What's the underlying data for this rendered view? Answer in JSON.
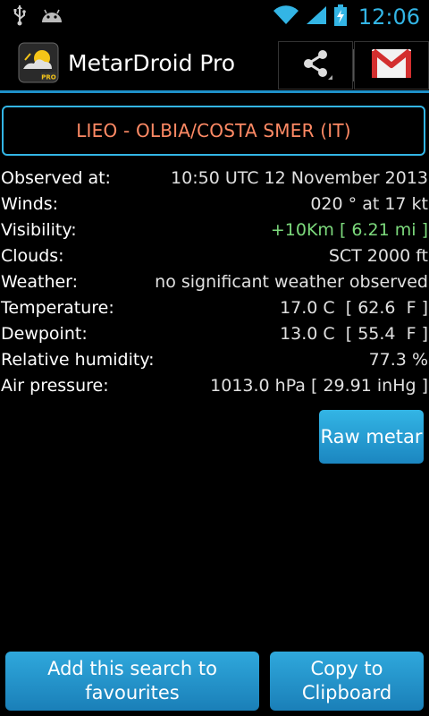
{
  "statusbar": {
    "time": "12:06",
    "icons": [
      "usb-icon",
      "android-icon",
      "wifi-icon",
      "signal-icon",
      "battery-charging-icon"
    ],
    "accent": "#33b5e5"
  },
  "actionbar": {
    "title": "MetarDroid Pro",
    "icon": "metardroid-logo-icon",
    "icon_badge": "PRO",
    "actions": [
      "share-icon",
      "gmail-icon"
    ]
  },
  "station": {
    "label": "LIEO - OLBIA/COSTA SMER (IT)",
    "color": "#ff8a65"
  },
  "report": [
    {
      "label": "Observed at:",
      "value": "10:50 UTC 12 November 2013"
    },
    {
      "label": "Winds:",
      "value": "020 ° at 17 kt"
    },
    {
      "label": "Visibility:",
      "value": "+10Km [ 6.21 mi ]"
    },
    {
      "label": "Clouds:",
      "value": "SCT 2000 ft"
    },
    {
      "label": "Weather:",
      "value": "no significant weather observed"
    },
    {
      "label": "Temperature:",
      "value": "17.0 C  [ 62.6  F ]"
    },
    {
      "label": "Dewpoint:",
      "value": "13.0 C  [ 55.4  F ]"
    },
    {
      "label": "Relative humidity:",
      "value": "77.3 %"
    },
    {
      "label": "Air pressure:",
      "value": "1013.0 hPa [ 29.91 inHg ]"
    }
  ],
  "buttons": {
    "raw_metar": "Raw metar",
    "add_favourites": "Add this search to\nfavourites",
    "copy_clipboard": "Copy to\nClipboard"
  }
}
